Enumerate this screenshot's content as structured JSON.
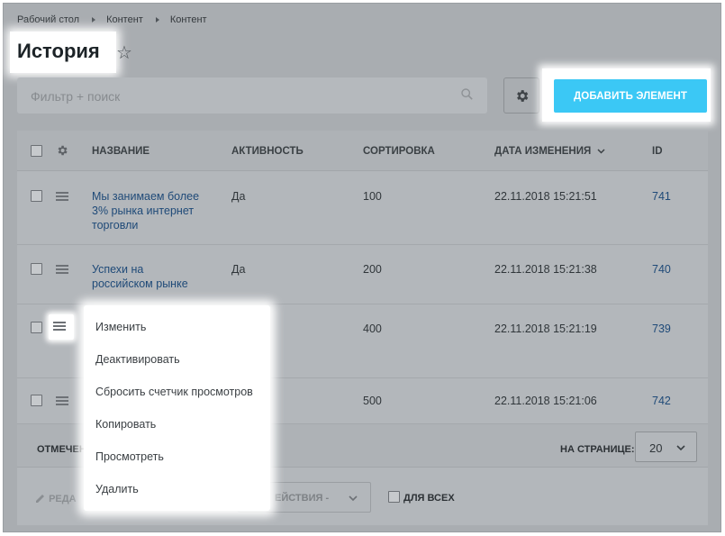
{
  "breadcrumb": [
    "Рабочий стол",
    "Контент",
    "Контент"
  ],
  "page_title": "История",
  "filter": {
    "placeholder": "Фильтр + поиск"
  },
  "add_button_label": "ДОБАВИТЬ ЭЛЕМЕНТ",
  "columns": {
    "name": "НАЗВАНИЕ",
    "active": "АКТИВНОСТЬ",
    "sort": "СОРТИРОВКА",
    "date": "ДАТА ИЗМЕНЕНИЯ",
    "id": "ID"
  },
  "rows": [
    {
      "name": "Мы занимаем более 3% рынка интернет торговли",
      "name_lines": [
        "Мы занимаем более",
        "3% рынка интернет",
        "торговли"
      ],
      "active": "Да",
      "sort": "100",
      "date": "22.11.2018 15:21:51",
      "id": "741"
    },
    {
      "name": "Успехи на российском рынке",
      "name_lines": [
        "Успехи на",
        "российском рынке"
      ],
      "active": "Да",
      "sort": "200",
      "date": "22.11.2018 15:21:38",
      "id": "740"
    },
    {
      "name": "",
      "name_lines": [],
      "active": "",
      "sort": "400",
      "date": "22.11.2018 15:21:19",
      "id": "739"
    },
    {
      "name": "",
      "name_lines": [],
      "active": "",
      "sort": "500",
      "date": "22.11.2018 15:21:06",
      "id": "742"
    }
  ],
  "footer": {
    "selected_label": "ОТМЕЧЕН",
    "per_page_label": "НА СТРАНИЦЕ:",
    "per_page_value": "20",
    "edit_label": "РЕДА",
    "actions_label": "ЕЙСТВИЯ -",
    "for_all_label": "ДЛЯ ВСЕХ"
  },
  "context_menu": {
    "items": [
      "Изменить",
      "Деактивировать",
      "Сбросить счетчик просмотров",
      "Копировать",
      "Просмотреть",
      "Удалить"
    ]
  },
  "colors": {
    "accent": "#3bc8f5",
    "link": "#1f4a78"
  }
}
